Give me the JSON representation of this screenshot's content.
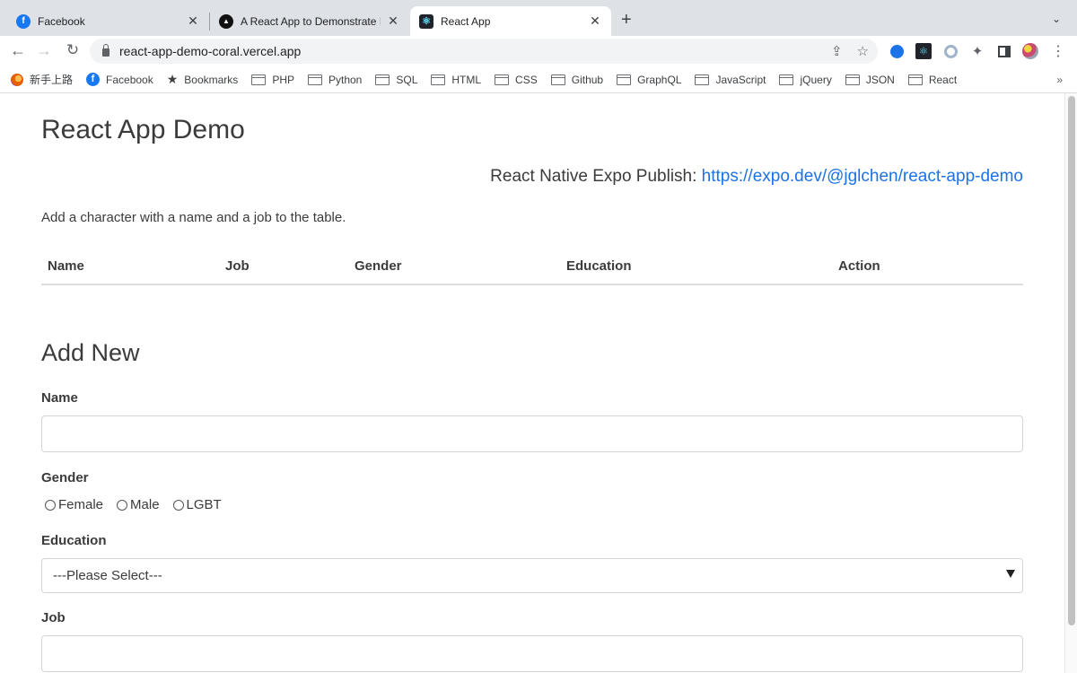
{
  "browser": {
    "tabs": [
      {
        "label": "Facebook",
        "icon": "facebook-icon",
        "active": false
      },
      {
        "label": "A React App to Demonstrate In",
        "icon": "vercel-icon",
        "active": false
      },
      {
        "label": "React App",
        "icon": "react-icon",
        "active": true
      }
    ],
    "new_tab": "+",
    "tab_search": "⌄",
    "url": "react-app-demo-coral.vercel.app",
    "bookmarks": [
      {
        "label": "新手上路",
        "icon": "firefox-icon"
      },
      {
        "label": "Facebook",
        "icon": "facebook-icon"
      },
      {
        "label": "Bookmarks",
        "icon": "star-icon"
      },
      {
        "label": "PHP",
        "icon": "folder-icon"
      },
      {
        "label": "Python",
        "icon": "folder-icon"
      },
      {
        "label": "SQL",
        "icon": "folder-icon"
      },
      {
        "label": "HTML",
        "icon": "folder-icon"
      },
      {
        "label": "CSS",
        "icon": "folder-icon"
      },
      {
        "label": "Github",
        "icon": "folder-icon"
      },
      {
        "label": "GraphQL",
        "icon": "folder-icon"
      },
      {
        "label": "JavaScript",
        "icon": "folder-icon"
      },
      {
        "label": "jQuery",
        "icon": "folder-icon"
      },
      {
        "label": "JSON",
        "icon": "folder-icon"
      },
      {
        "label": "React",
        "icon": "folder-icon"
      }
    ],
    "bookmarks_more": "»",
    "colors": {
      "tabstrip": "#dee1e6",
      "link": "#1a73e8",
      "facebook": "#1877f2"
    }
  },
  "page": {
    "title": "React App Demo",
    "expo_label": "React Native Expo Publish:",
    "expo_link": "https://expo.dev/@jglchen/react-app-demo",
    "description": "Add a character with a name and a job to the table.",
    "table": {
      "headers": [
        "Name",
        "Job",
        "Gender",
        "Education",
        "Action"
      ],
      "rows": []
    },
    "form": {
      "heading": "Add New",
      "name_label": "Name",
      "name_value": "",
      "gender_label": "Gender",
      "gender_options": [
        "Female",
        "Male",
        "LGBT"
      ],
      "education_label": "Education",
      "education_selected": "---Please Select---",
      "job_label": "Job",
      "job_value": ""
    }
  }
}
